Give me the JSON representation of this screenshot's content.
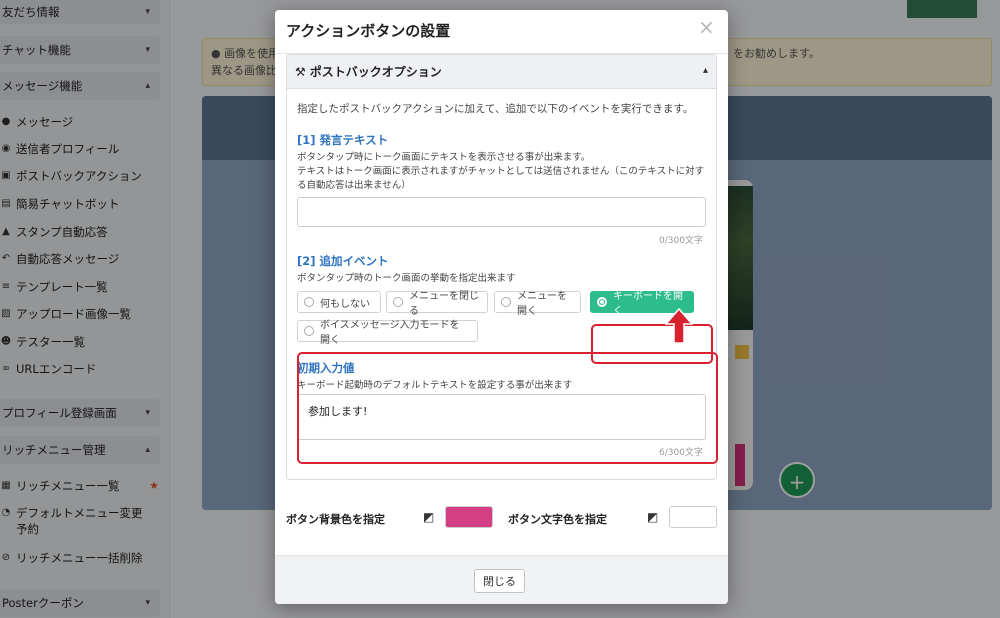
{
  "sidebar": {
    "sections": [
      {
        "label": "友だち情報",
        "chevron": "down"
      },
      {
        "label": "チャット機能",
        "chevron": "down"
      },
      {
        "label": "メッセージ機能",
        "chevron": "up"
      },
      {
        "label": "プロフィール登録画面",
        "chevron": "down"
      },
      {
        "label": "リッチメニュー管理",
        "chevron": "up"
      },
      {
        "label": "Posterクーポン",
        "chevron": "down"
      }
    ],
    "message_items": [
      {
        "icon": "chat-icon",
        "label": "メッセージ"
      },
      {
        "icon": "user-circle-icon",
        "label": "送信者プロフィール"
      },
      {
        "icon": "robot-icon",
        "label": "ポストバックアクション"
      },
      {
        "icon": "chatbot-icon",
        "label": "簡易チャットボット"
      },
      {
        "icon": "stamp-icon",
        "label": "スタンプ自動応答"
      },
      {
        "icon": "reply-icon",
        "label": "自動応答メッセージ"
      },
      {
        "icon": "list-icon",
        "label": "テンプレート一覧"
      },
      {
        "icon": "image-icon",
        "label": "アップロード画像一覧"
      },
      {
        "icon": "users-icon",
        "label": "テスター一覧"
      },
      {
        "icon": "link-icon",
        "label": "URLエンコード"
      }
    ],
    "richmenu_items": [
      {
        "icon": "table-icon",
        "label": "リッチメニュー一覧",
        "star": "★"
      },
      {
        "icon": "clock-icon",
        "label": "デフォルトメニュー変更予約"
      },
      {
        "icon": "ban-icon",
        "label": "リッチメニュー一括削除"
      }
    ]
  },
  "background": {
    "alert_line1": "画像を使用",
    "alert_line1_right": "をお勧めします。",
    "alert_line2": "異なる画像比"
  },
  "modal": {
    "title": "アクションボタンの設置",
    "close_glyph": "×",
    "panel_title": "ポストバックオプション",
    "intro": "指定したポストバックアクションに加えて、追加で以下のイベントを実行できます。",
    "speech": {
      "heading": "[1] 発言テキスト",
      "desc1": "ボタンタップ時にトーク画面にテキストを表示させる事が出来ます。",
      "desc2": "テキストはトーク画面に表示されますがチャットとしては送信されません（このテキストに対する自動応答は出来ません）",
      "value": "",
      "counter": "0/300文字"
    },
    "event": {
      "heading": "[2] 追加イベント",
      "desc": "ボタンタップ時のトーク画面の挙動を指定出来ます",
      "options": [
        {
          "label": "何もしない",
          "selected": false
        },
        {
          "label": "メニューを閉じる",
          "selected": false
        },
        {
          "label": "メニューを開く",
          "selected": false
        },
        {
          "label": "キーボードを開く",
          "selected": true
        },
        {
          "label": "ボイスメッセージ入力モードを開く",
          "selected": false
        }
      ]
    },
    "initial": {
      "heading": "初期入力値",
      "desc": "キーボード起動時のデフォルトテキストを設定する事が出来ます",
      "value": "参加します!",
      "counter": "6/300文字"
    },
    "colors": {
      "bg_label": "ボタン背景色を指定",
      "bg_value": "#d43f86",
      "text_label": "ボタン文字色を指定",
      "text_value": "#ffffff",
      "highlight": "#d9222f",
      "accent": "#2dbd8c"
    },
    "footer": {
      "close_label": "閉じる"
    }
  }
}
